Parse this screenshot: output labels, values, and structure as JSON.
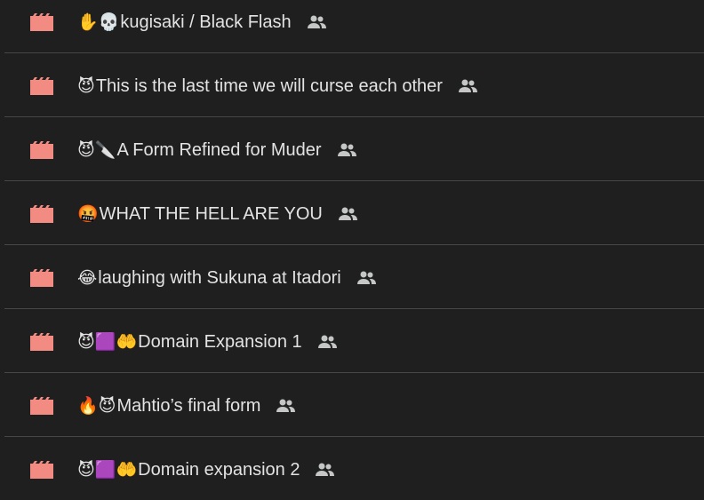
{
  "colors": {
    "background": "#1f1f1f",
    "divider": "#444746",
    "text": "#e3e3e3",
    "video_icon": "#f28b82",
    "shared_icon": "#c4c7c5"
  },
  "icons": {
    "file_type": "video-file-icon",
    "sharing": "shared-people-icon"
  },
  "files": [
    {
      "emoji": "✋💀",
      "name": "kugisaki / Black Flash"
    },
    {
      "emoji": "😈",
      "name": "This is the last time we will curse each other"
    },
    {
      "emoji": "😈🔪",
      "name": "A Form Refined for Muder"
    },
    {
      "emoji": "🤬",
      "name": "WHAT THE HELL ARE YOU"
    },
    {
      "emoji": "😂",
      "name": "laughing with Sukuna at Itadori"
    },
    {
      "emoji": "😈🟪🤲",
      "name": "Domain Expansion 1"
    },
    {
      "emoji": "🔥😈",
      "name": "Mahtio’s final form"
    },
    {
      "emoji": "😈🟪🤲",
      "name": "Domain expansion 2"
    }
  ]
}
